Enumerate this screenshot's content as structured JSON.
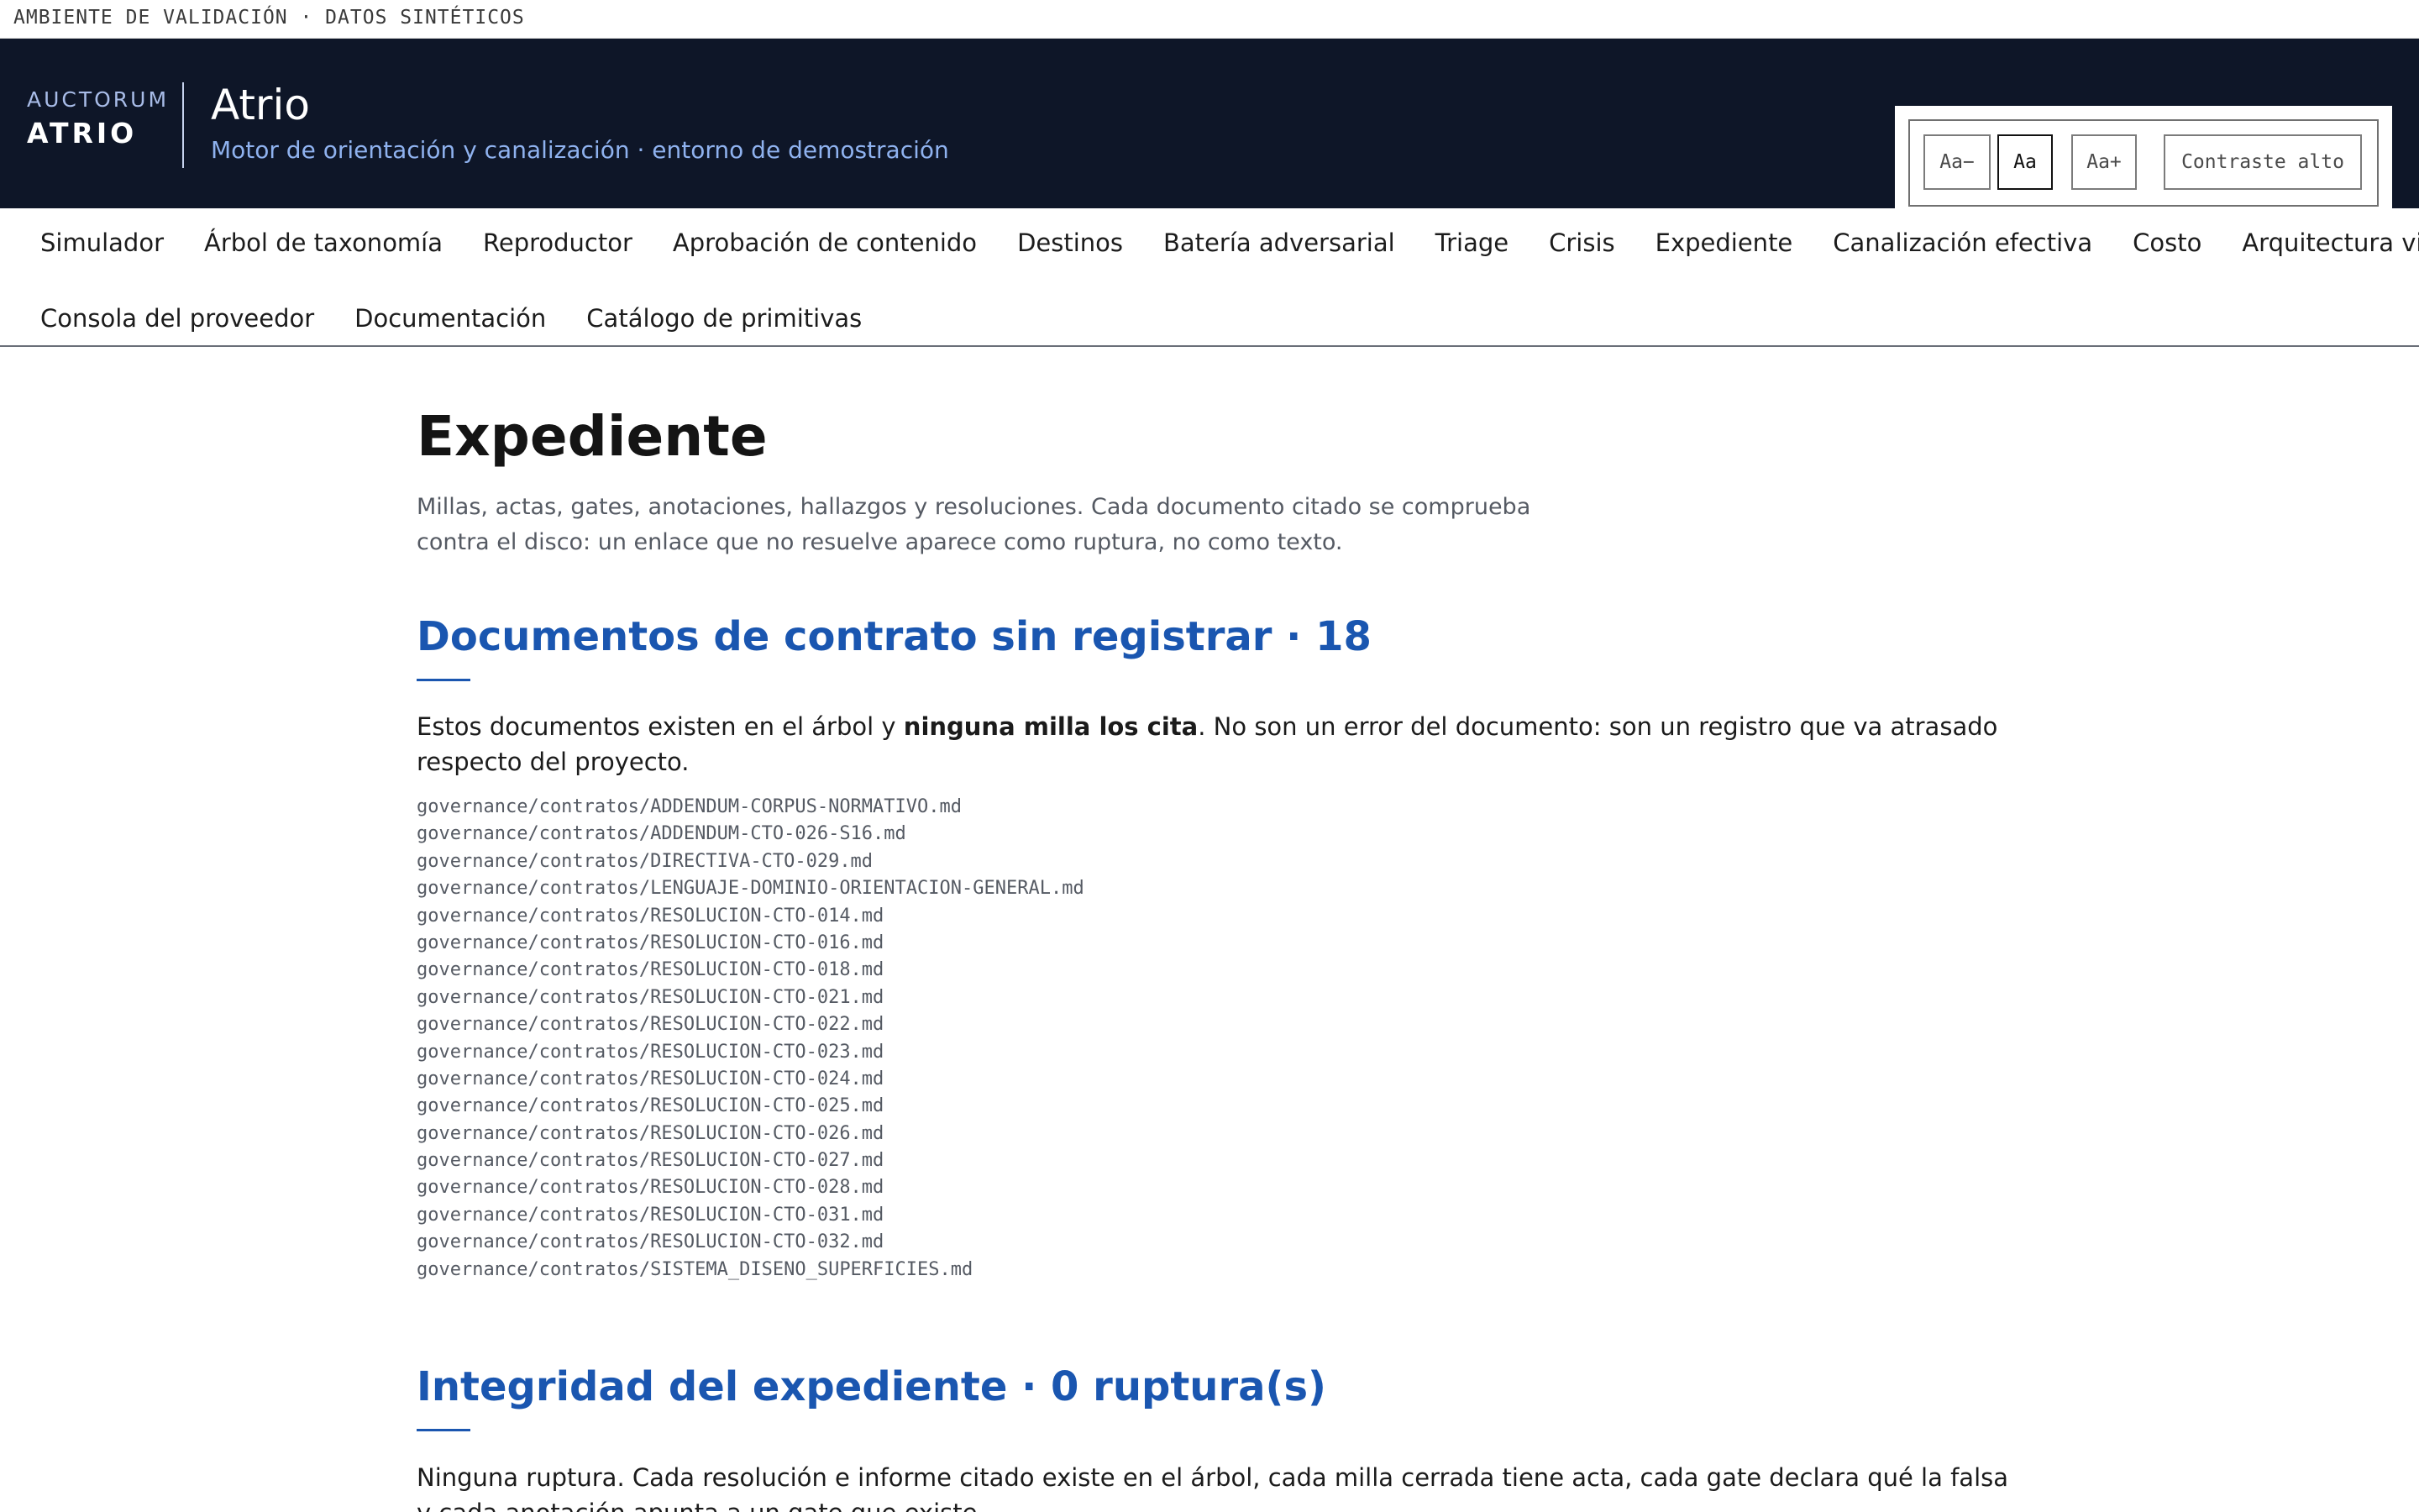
{
  "env_banner": "AMBIENTE DE VALIDACIÓN · DATOS SINTÉTICOS",
  "brand": {
    "small": "AUCTORUM",
    "big": "ATRIO"
  },
  "app": {
    "title": "Atrio",
    "subtitle": "Motor de orientación y canalización · entorno de demostración"
  },
  "a11y": {
    "decrease": "Aa−",
    "normal": "Aa",
    "increase": "Aa+",
    "contrast": "Contraste alto",
    "active": "Aa"
  },
  "nav": {
    "row1": [
      "Simulador",
      "Árbol de taxonomía",
      "Reproductor",
      "Aprobación de contenido",
      "Destinos",
      "Batería adversarial",
      "Triage",
      "Crisis",
      "Expediente",
      "Canalización efectiva",
      "Costo",
      "Arquitectura viva"
    ],
    "row2": [
      "Consola del proveedor",
      "Documentación",
      "Catálogo de primitivas"
    ]
  },
  "page": {
    "title": "Expediente",
    "description": "Millas, actas, gates, anotaciones, hallazgos y resoluciones. Cada documento citado se comprueba contra el disco: un enlace que no resuelve aparece como ruptura, no como texto."
  },
  "unregistered": {
    "title": "Documentos de contrato sin registrar · 18",
    "text_before": "Estos documentos existen en el árbol y ",
    "text_bold": "ninguna milla los cita",
    "text_after": ". No son un error del documento: son un registro que va atrasado respecto del proyecto.",
    "files": [
      "governance/contratos/ADDENDUM-CORPUS-NORMATIVO.md",
      "governance/contratos/ADDENDUM-CTO-026-S16.md",
      "governance/contratos/DIRECTIVA-CTO-029.md",
      "governance/contratos/LENGUAJE-DOMINIO-ORIENTACION-GENERAL.md",
      "governance/contratos/RESOLUCION-CTO-014.md",
      "governance/contratos/RESOLUCION-CTO-016.md",
      "governance/contratos/RESOLUCION-CTO-018.md",
      "governance/contratos/RESOLUCION-CTO-021.md",
      "governance/contratos/RESOLUCION-CTO-022.md",
      "governance/contratos/RESOLUCION-CTO-023.md",
      "governance/contratos/RESOLUCION-CTO-024.md",
      "governance/contratos/RESOLUCION-CTO-025.md",
      "governance/contratos/RESOLUCION-CTO-026.md",
      "governance/contratos/RESOLUCION-CTO-027.md",
      "governance/contratos/RESOLUCION-CTO-028.md",
      "governance/contratos/RESOLUCION-CTO-031.md",
      "governance/contratos/RESOLUCION-CTO-032.md",
      "governance/contratos/SISTEMA_DISENO_SUPERFICIES.md"
    ]
  },
  "integrity": {
    "title": "Integridad del expediente · 0 ruptura(s)",
    "text": "Ninguna ruptura. Cada resolución e informe citado existe en el árbol, cada milla cerrada tiene acta, cada gate declara qué la falsa y cada anotación apunta a un gate que existe."
  },
  "colors": {
    "header_bg": "#0e1628",
    "accent": "#1a56b0",
    "subtitle": "#8fb2ef"
  }
}
